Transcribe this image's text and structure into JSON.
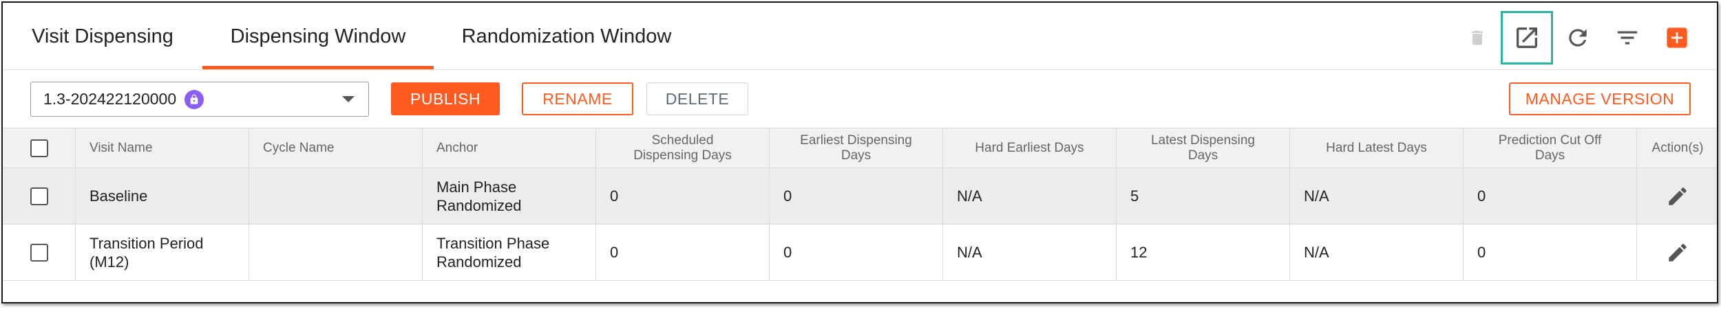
{
  "tabs": [
    {
      "label": "Visit Dispensing"
    },
    {
      "label": "Dispensing Window"
    },
    {
      "label": "Randomization Window"
    }
  ],
  "active_tab": "Dispensing Window",
  "toolbar_icons": [
    "trash-icon",
    "open-in-new-icon",
    "refresh-icon",
    "filter-icon",
    "add-icon"
  ],
  "version": {
    "selected": "1.3-202422120000"
  },
  "buttons": {
    "publish": "PUBLISH",
    "rename": "RENAME",
    "delete": "DELETE",
    "manage_version": "MANAGE VERSION"
  },
  "table": {
    "headers": {
      "visit_name": "Visit Name",
      "cycle_name": "Cycle Name",
      "anchor": "Anchor",
      "scheduled": "Scheduled Dispensing Days",
      "earliest": "Earliest Dispensing Days",
      "hard_earliest": "Hard Earliest Days",
      "latest": "Latest Dispensing Days",
      "hard_latest": "Hard Latest Days",
      "prediction": "Prediction Cut Off Days",
      "actions": "Action(s)"
    },
    "rows": [
      {
        "visit_name": "Baseline",
        "cycle_name": "",
        "anchor": "Main Phase Randomized",
        "scheduled": "0",
        "earliest": "0",
        "hard_earliest": "N/A",
        "latest": "5",
        "hard_latest": "N/A",
        "prediction": "0"
      },
      {
        "visit_name": "Transition Period (M12)",
        "cycle_name": "",
        "anchor": "Transition Phase Randomized",
        "scheduled": "0",
        "earliest": "0",
        "hard_earliest": "N/A",
        "latest": "12",
        "hard_latest": "N/A",
        "prediction": "0"
      }
    ]
  },
  "colors": {
    "accent": "#ff5a1f",
    "highlight": "#2ab3a0",
    "lock_badge": "#8b5cf6"
  }
}
